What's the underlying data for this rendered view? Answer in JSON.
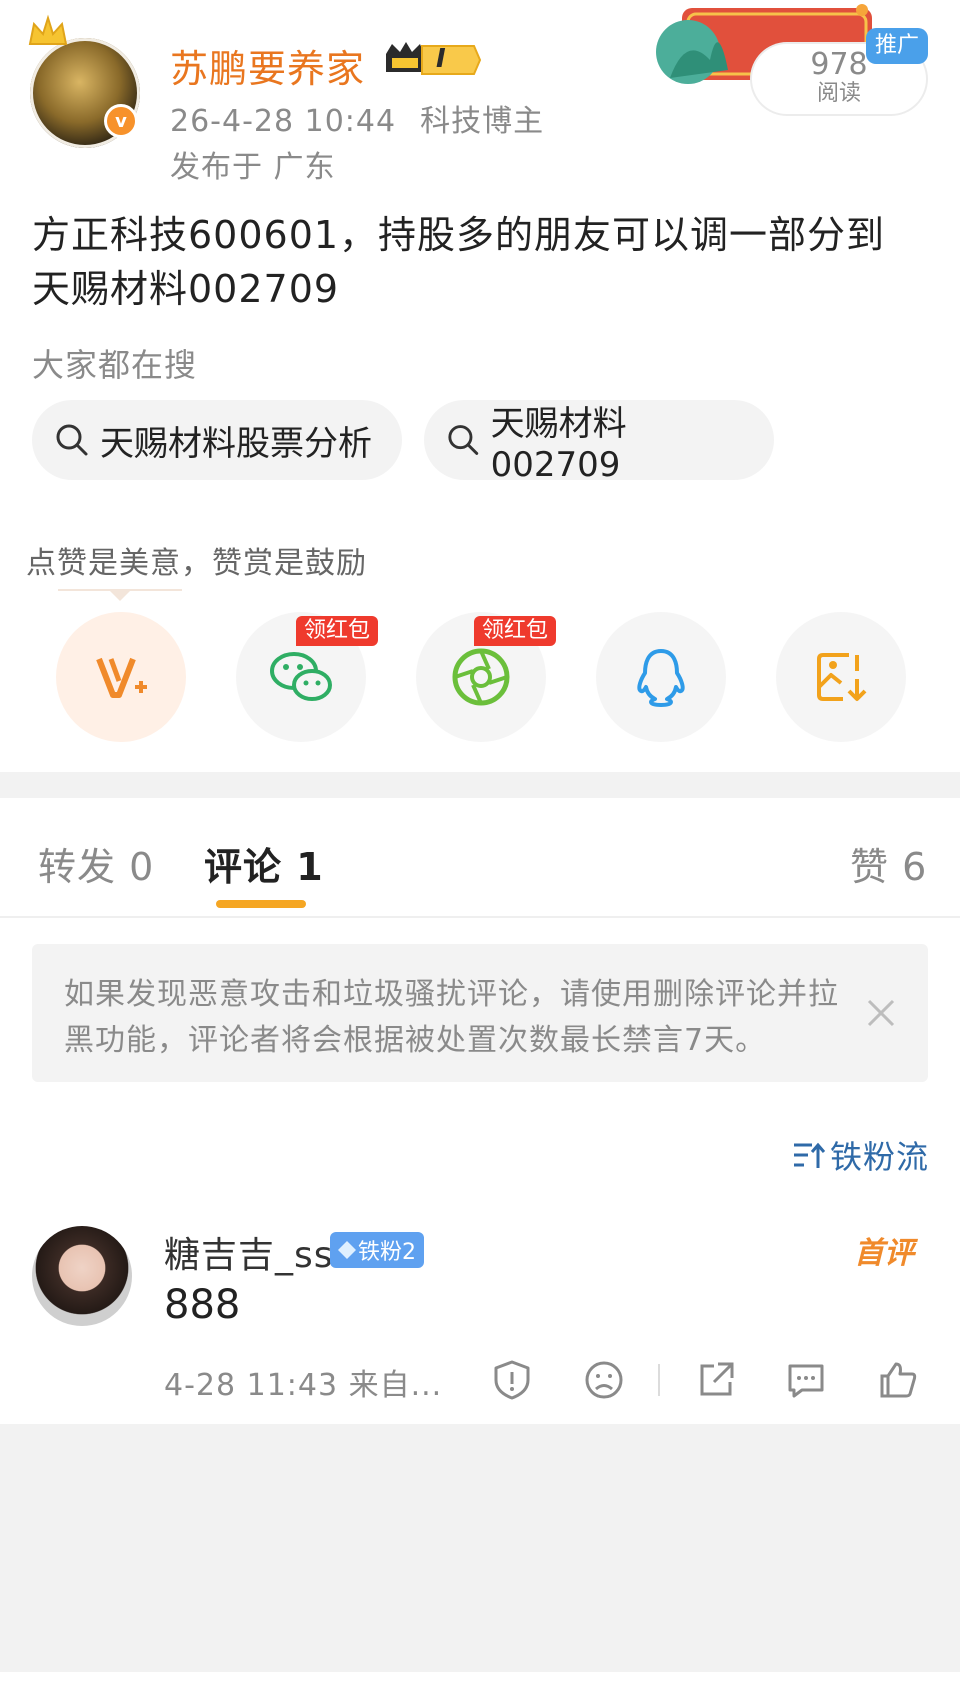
{
  "header": {
    "username": "苏鹏要养家",
    "vip_level": "I",
    "timestamp": "26-4-28 10:44",
    "category": "科技博主",
    "location": "发布于 广东",
    "reads_count": "978",
    "reads_label": "阅读",
    "promo_label": "推广",
    "verified_mark": "v"
  },
  "post": {
    "text": "方正科技600601，持股多的朋友可以调一部分到天赐材料002709"
  },
  "search": {
    "title": "大家都在搜",
    "chips": [
      "天赐材料股票分析",
      "天赐材料002709"
    ]
  },
  "share": {
    "tip": "点赞是美意，赞赏是鼓励",
    "red_packet_label": "领红包",
    "buttons": [
      "v-plus-icon",
      "wechat-icon",
      "moments-icon",
      "qq-icon",
      "save-image-icon"
    ]
  },
  "tabs": {
    "repost": "转发 0",
    "comment": "评论 1",
    "like": "赞 6"
  },
  "notice": {
    "text": "如果发现恶意攻击和垃圾骚扰评论，请使用删除评论并拉黑功能，评论者将会根据被处置次数最长禁言7天。"
  },
  "sort": {
    "label": "铁粉流"
  },
  "comment": {
    "name": "糖吉吉_ss",
    "badge": "铁粉2",
    "first_label": "首评",
    "text": "888",
    "meta": "4-28 11:43 来自..."
  },
  "colors": {
    "accent_orange": "#e9761f",
    "tab_underline": "#f5a623",
    "link_blue": "#2f6aa8",
    "red_badge": "#ef3a2d"
  }
}
